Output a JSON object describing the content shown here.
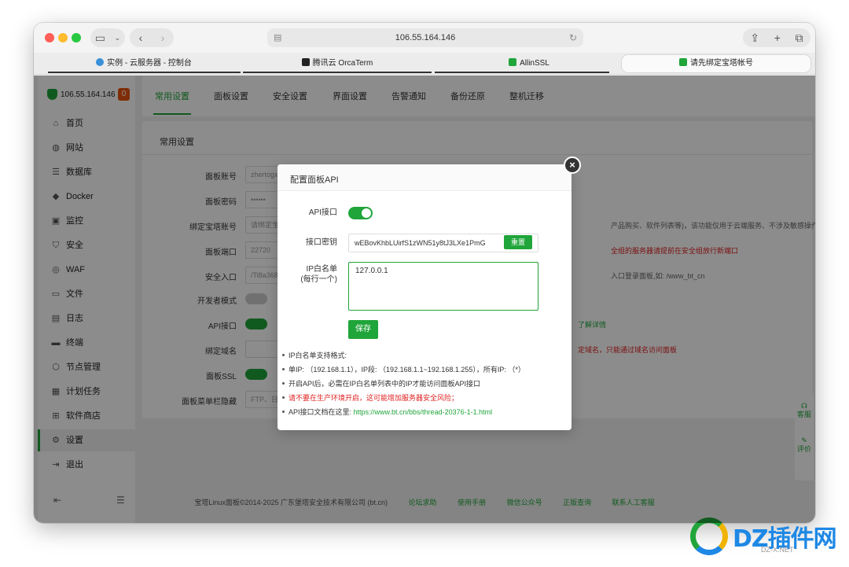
{
  "browser": {
    "address": "106.55.164.146",
    "tabs": [
      {
        "label": "实例 - 云服务器 - 控制台"
      },
      {
        "label": "腾讯云 OrcaTerm"
      },
      {
        "label": "AllinSSL"
      },
      {
        "label": "请先绑定宝塔帐号"
      }
    ]
  },
  "sidebar": {
    "host": "106.55.164.146",
    "badge": "0",
    "items": [
      {
        "label": "首页",
        "icon": "home-icon"
      },
      {
        "label": "网站",
        "icon": "globe-icon"
      },
      {
        "label": "数据库",
        "icon": "database-icon"
      },
      {
        "label": "Docker",
        "icon": "docker-icon"
      },
      {
        "label": "监控",
        "icon": "monitor-icon"
      },
      {
        "label": "安全",
        "icon": "shield-icon"
      },
      {
        "label": "WAF",
        "icon": "waf-icon"
      },
      {
        "label": "文件",
        "icon": "folder-icon"
      },
      {
        "label": "日志",
        "icon": "log-icon"
      },
      {
        "label": "终端",
        "icon": "terminal-icon"
      },
      {
        "label": "节点管理",
        "icon": "node-icon"
      },
      {
        "label": "计划任务",
        "icon": "calendar-icon"
      },
      {
        "label": "软件商店",
        "icon": "store-icon"
      },
      {
        "label": "设置",
        "icon": "gear-icon"
      },
      {
        "label": "退出",
        "icon": "logout-icon"
      }
    ]
  },
  "topnav": [
    "常用设置",
    "面板设置",
    "安全设置",
    "界面设置",
    "告警通知",
    "备份还原",
    "整机迁移"
  ],
  "card": {
    "title": "常用设置",
    "rows": [
      {
        "label": "面板账号",
        "value": "zhertogx"
      },
      {
        "label": "面板密码",
        "value": "••••••"
      },
      {
        "label": "绑定宝塔账号",
        "value": "请绑定宝"
      },
      {
        "label": "面板端口",
        "value": "22720"
      },
      {
        "label": "安全入口",
        "value": "/Ti8a368"
      },
      {
        "label": "开发者模式",
        "value": ""
      },
      {
        "label": "API接口",
        "value": ""
      },
      {
        "label": "绑定域名",
        "value": ""
      },
      {
        "label": "面板SSL",
        "value": ""
      },
      {
        "label": "面板菜单栏隐藏",
        "value": "FTP、日"
      }
    ],
    "hints": {
      "bind": "产品购买、软件列表等)，该功能仅用于云端服务、不涉及敏感操作",
      "port": "全组的服务器请提前在安全组放行新端口",
      "entry": "入口登录面板,如: /www_bt_cn",
      "api": "了解详情",
      "domain": "定域名，只能通过域名访问面板"
    }
  },
  "side_float": {
    "service": "客服",
    "rate": "评价"
  },
  "footer": {
    "copyright": "宝塔Linux面板©2014-2025 广东堡塔安全技术有限公司 (bt.cn)",
    "links": [
      "论坛求助",
      "使用手册",
      "微信公众号",
      "正版查询",
      "联系人工客服"
    ]
  },
  "modal": {
    "title": "配置面板API",
    "api_label": "API接口",
    "key_label": "接口密钥",
    "key_value": "wEBovKhbLUirfS1zWN51y8tJ3LXe1PmG",
    "reset_label": "重置",
    "whitelist_label_1": "IP白名单",
    "whitelist_label_2": "(每行一个)",
    "whitelist_value": "127.0.0.1",
    "save_label": "保存",
    "notes": [
      "IP白名单支持格式:",
      "单IP: （192.168.1.1），IP段: （192.168.1.1~192.168.1.255），所有IP: （*）",
      "开启API后，必需在IP白名单列表中的IP才能访问面板API接口",
      "请不要在生产环境开启，这可能增加服务器安全风险；"
    ],
    "doc_prefix": "API接口文档在这里: ",
    "doc_link": "https://www.bt.cn/bbs/thread-20376-1-1.html"
  },
  "watermark": {
    "text": "DZ插件网",
    "sub": "DZ-X.NET"
  }
}
